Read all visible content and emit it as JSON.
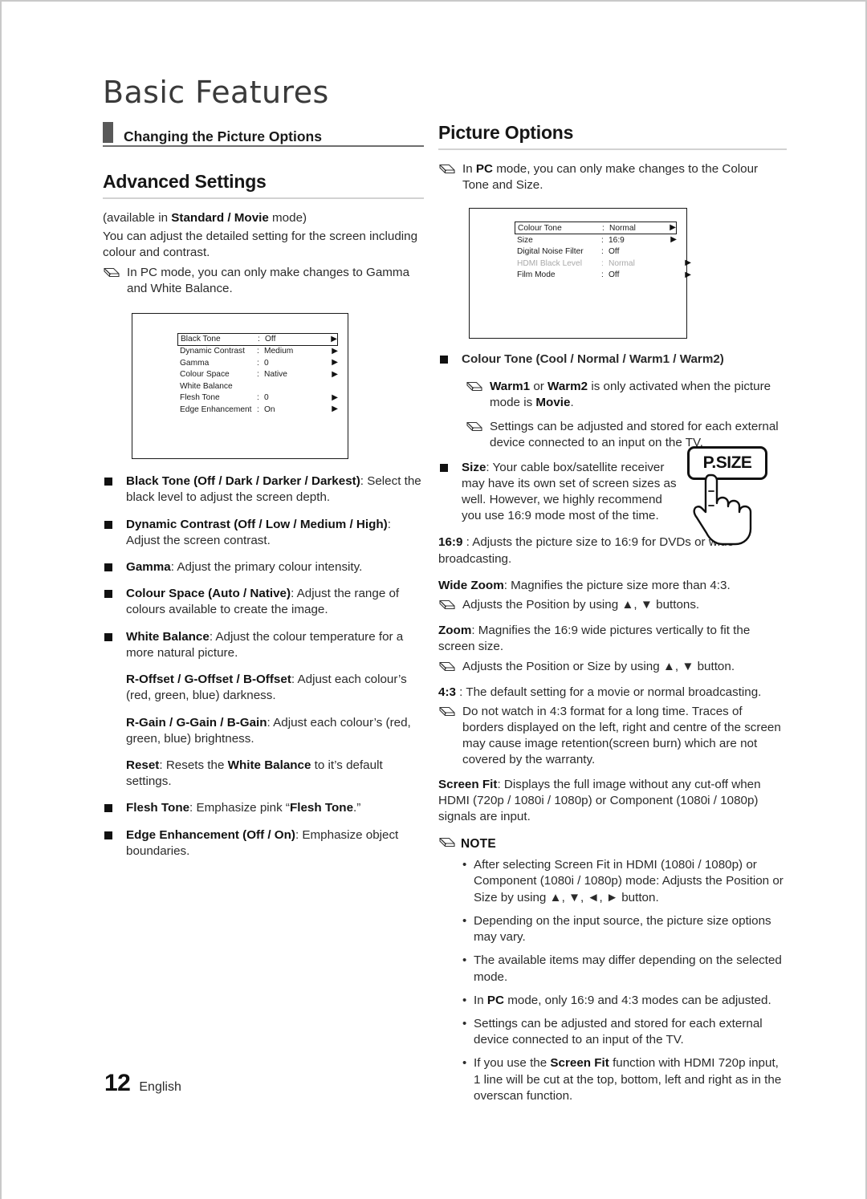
{
  "page": {
    "chapter_title": "Basic Features",
    "page_number": "12",
    "language": "English"
  },
  "left_column": {
    "section_header": "Changing the Picture Options",
    "heading": "Advanced Settings",
    "intro_prefix": "(available in ",
    "intro_bold": "Standard / Movie",
    "intro_suffix": " mode)",
    "intro_line2": "You can adjust the detailed setting for the screen including colour and contrast.",
    "note_pc": "In PC mode, you can only make changes to Gamma and White Balance.",
    "osd_menu": {
      "rows": [
        {
          "label": "Black Tone",
          "value": "Off",
          "arrow": true,
          "highlighted": true,
          "dim": false
        },
        {
          "label": "Dynamic Contrast",
          "value": "Medium",
          "arrow": true,
          "highlighted": false,
          "dim": false
        },
        {
          "label": "Gamma",
          "value": "0",
          "arrow": true,
          "highlighted": false,
          "dim": false
        },
        {
          "label": "Colour Space",
          "value": "Native",
          "arrow": true,
          "highlighted": false,
          "dim": false
        },
        {
          "label": "White Balance",
          "value": "",
          "arrow": false,
          "highlighted": false,
          "dim": false
        },
        {
          "label": "Flesh Tone",
          "value": "0",
          "arrow": true,
          "highlighted": false,
          "dim": false
        },
        {
          "label": "Edge Enhancement",
          "value": "On",
          "arrow": true,
          "highlighted": false,
          "dim": false
        }
      ]
    },
    "bullets": [
      {
        "bold": "Black Tone (Off / Dark / Darker / Darkest)",
        "rest": ": Select the black level to adjust the screen depth."
      },
      {
        "bold": "Dynamic Contrast (Off / Low / Medium / High)",
        "rest": ": Adjust the screen contrast."
      },
      {
        "bold": "Gamma",
        "rest": ": Adjust the primary colour intensity."
      },
      {
        "bold": "Colour Space (Auto / Native)",
        "rest": ": Adjust the range of colours available to create the image."
      },
      {
        "bold": "White Balance",
        "rest": ": Adjust the colour temperature for a more natural picture."
      }
    ],
    "sub_paragraphs": [
      {
        "bold": "R-Offset / G-Offset / B-Offset",
        "rest": ": Adjust each colour’s (red, green, blue) darkness."
      },
      {
        "bold": "R-Gain / G-Gain / B-Gain",
        "rest": ": Adjust each colour’s (red, green, blue) brightness."
      }
    ],
    "reset_bold": "Reset",
    "reset_mid": ": Resets the ",
    "reset_bold2": "White Balance",
    "reset_rest": " to it’s default settings.",
    "bullets_tail": [
      {
        "bold": "Flesh Tone",
        "rest": ": Emphasize pink “",
        "bold2": "Flesh Tone",
        "rest2": ".”"
      },
      {
        "bold": "Edge Enhancement (Off / On)",
        "rest": ": Emphasize object boundaries.",
        "bold2": "",
        "rest2": ""
      }
    ]
  },
  "right_column": {
    "heading": "Picture Options",
    "note_pc_prefix": "In ",
    "note_pc_bold": "PC",
    "note_pc_rest": " mode, you can only make changes to the Colour Tone and Size.",
    "osd_menu": {
      "rows": [
        {
          "label": "Colour Tone",
          "value": "Normal",
          "arrow": true,
          "arrow_far": false,
          "highlighted": true,
          "dim": false
        },
        {
          "label": "Size",
          "value": "16:9",
          "arrow": true,
          "arrow_far": false,
          "highlighted": false,
          "dim": false
        },
        {
          "label": "Digital Noise Filter",
          "value": "Off",
          "arrow": false,
          "arrow_far": false,
          "highlighted": false,
          "dim": false
        },
        {
          "label": "HDMI Black Level",
          "value": "Normal",
          "arrow": true,
          "arrow_far": true,
          "highlighted": false,
          "dim": true
        },
        {
          "label": "Film Mode",
          "value": "Off",
          "arrow": true,
          "arrow_far": true,
          "highlighted": false,
          "dim": false
        }
      ]
    },
    "colour_tone_bullet": "Colour Tone (Cool / Normal / Warm1 / Warm2)",
    "colour_tone_notes": [
      {
        "bold1": "Warm1",
        "mid": " or ",
        "bold2": "Warm2",
        "rest": " is only activated when the picture mode is ",
        "bold3": "Movie",
        "tail": "."
      },
      {
        "bold1": "",
        "mid": "",
        "bold2": "",
        "rest": "Settings can be adjusted and stored for each external device connected to an input on the TV.",
        "bold3": "",
        "tail": ""
      }
    ],
    "size_bullet_bold": "Size",
    "size_bullet_rest": ": Your cable box/satellite receiver may have its own set of screen sizes as well. However, we highly recommend you use 16:9 mode most of the time.",
    "remote_button_label": "P.SIZE",
    "size_items": [
      {
        "bold": "16:9",
        "rest": " : Adjusts the picture size to 16:9 for DVDs or wide broadcasting.",
        "note": ""
      },
      {
        "bold": "Wide Zoom",
        "rest": ": Magnifies the picture size more than 4:3.",
        "note": "Adjusts the Position by using ▲, ▼ buttons."
      },
      {
        "bold": "Zoom",
        "rest": ": Magnifies the 16:9 wide pictures vertically to fit the screen size.",
        "note": "Adjusts the Position or Size by using ▲, ▼ button."
      },
      {
        "bold": "4:3",
        "rest": " : The default setting for a movie or normal broadcasting.",
        "note": "Do not watch in 4:3 format for a long time. Traces of borders displayed on the left, right and centre of the screen may cause image retention(screen burn) which are not covered by the warranty."
      }
    ],
    "screen_fit_bold": "Screen Fit",
    "screen_fit_rest": ": Displays the full image without any cut-off when HDMI (720p / 1080i / 1080p) or Component (1080i / 1080p) signals are input.",
    "note_title": "NOTE",
    "notes": [
      {
        "text_a": "After selecting Screen Fit in HDMI (1080i / 1080p) or Component (1080i / 1080p) mode: Adjusts the Position or Size by using ▲, ▼, ◄, ► button.",
        "bold": "",
        "text_b": ""
      },
      {
        "text_a": "Depending on the input source, the picture size options may vary.",
        "bold": "",
        "text_b": ""
      },
      {
        "text_a": "The available items may differ depending on the selected mode.",
        "bold": "",
        "text_b": ""
      },
      {
        "text_a": "In ",
        "bold": "PC",
        "text_b": " mode, only 16:9 and 4:3 modes can be adjusted."
      },
      {
        "text_a": "Settings can be adjusted and stored for each external device connected to an input of the TV.",
        "bold": "",
        "text_b": ""
      },
      {
        "text_a": "If you use the ",
        "bold": "Screen Fit",
        "text_b": " function with HDMI 720p input, 1 line will be cut at the top, bottom, left and right as in the overscan function."
      }
    ]
  },
  "icons": {
    "pencil": "pencil-note-icon",
    "square_bullet": "square-bullet-icon",
    "right_arrow": "right-arrow-icon",
    "hand": "pointing-hand-icon"
  }
}
